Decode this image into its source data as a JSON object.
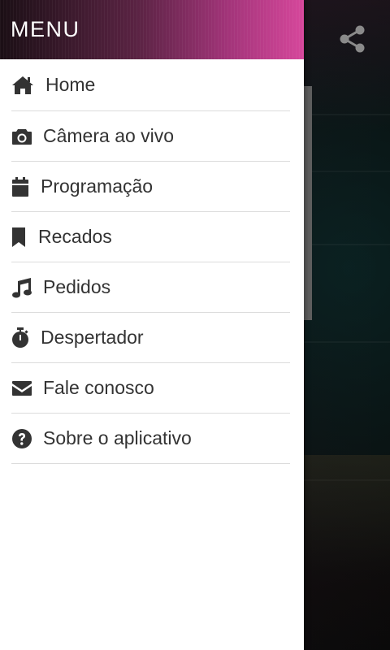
{
  "drawer": {
    "title": "MENU",
    "items": [
      {
        "label": "Home",
        "icon": "home-icon"
      },
      {
        "label": "Câmera ao vivo",
        "icon": "camera-icon"
      },
      {
        "label": "Programação",
        "icon": "calendar-icon"
      },
      {
        "label": "Recados",
        "icon": "bookmark-icon"
      },
      {
        "label": "Pedidos",
        "icon": "music-note-icon"
      },
      {
        "label": "Despertador",
        "icon": "stopwatch-icon"
      },
      {
        "label": "Fale conosco",
        "icon": "envelope-icon"
      },
      {
        "label": "Sobre o aplicativo",
        "icon": "question-circle-icon"
      }
    ]
  },
  "toolbar": {
    "share_icon": "share-icon"
  },
  "colors": {
    "header_gradient_start": "#1b0f15",
    "header_gradient_end": "#d6479b",
    "menu_text": "#333333",
    "divider": "#dcdcdc"
  }
}
